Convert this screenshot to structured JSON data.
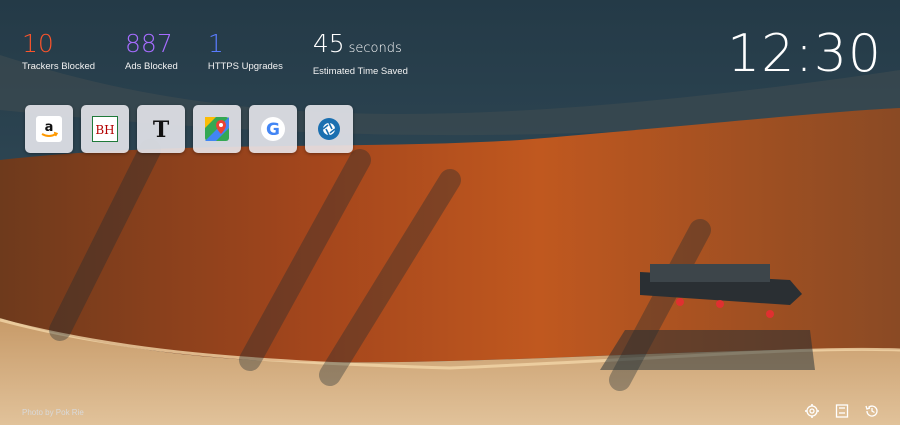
{
  "stats": [
    {
      "value": "10",
      "label": "Trackers Blocked",
      "color": "#fb542b"
    },
    {
      "value": "887",
      "label": "Ads Blocked",
      "color": "#a66cff"
    },
    {
      "value": "1",
      "label": "HTTPS Upgrades",
      "color": "#5a7cff"
    },
    {
      "value": "45",
      "unit": "seconds",
      "label": "Estimated Time Saved",
      "color": "#ffffff"
    }
  ],
  "clock": "12:30",
  "tiles": [
    {
      "name": "amazon",
      "icon": "amazon-logo-icon"
    },
    {
      "name": "bh",
      "icon": "bh-logo-icon",
      "text": "BH"
    },
    {
      "name": "nytimes",
      "icon": "nytimes-logo-icon",
      "text": "T"
    },
    {
      "name": "google-maps",
      "icon": "maps-pin-icon"
    },
    {
      "name": "google",
      "icon": "google-logo-icon",
      "text": "G"
    },
    {
      "name": "shutter",
      "icon": "aperture-icon"
    }
  ],
  "credit": "Photo by Pok Rie",
  "toolbar": [
    "gear-icon",
    "bookmark-icon",
    "history-icon"
  ]
}
